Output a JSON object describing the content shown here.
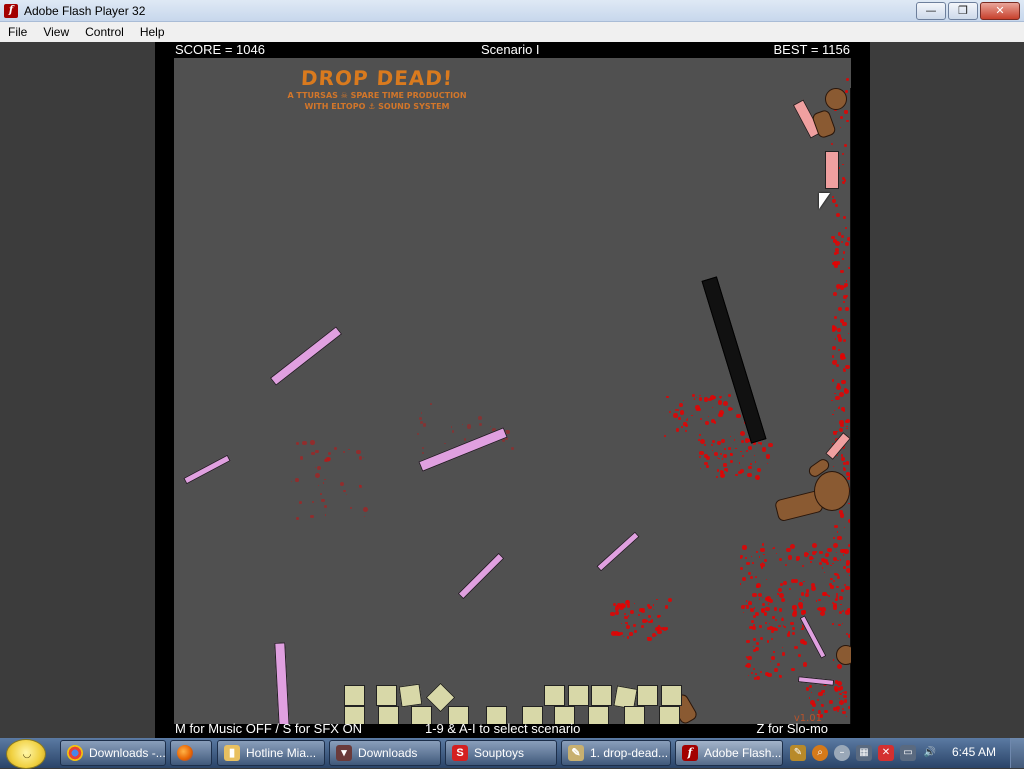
{
  "window": {
    "title": "Adobe Flash Player 32",
    "minimize_glyph": "—",
    "restore_glyph": "❐",
    "close_glyph": "✕"
  },
  "menu": [
    "File",
    "View",
    "Control",
    "Help"
  ],
  "game": {
    "score": "SCORE = 1046",
    "scenario": "Scenario I",
    "best": "BEST = 1156",
    "logo_title": "DROP DEAD!",
    "logo_line1": "A TTURSAS ☠ SPARE TIME PRODUCTION",
    "logo_line2": "WITH ELTOPO ⚓ SOUND SYSTEM",
    "hint_music": "M for Music OFF / S for SFX ON",
    "hint_scenario": "1-9 & A-I to select scenario",
    "hint_slowmo": "Z for Slo-mo",
    "version": "v1.01"
  },
  "colors": {
    "plank_pink": "#e0a0e0",
    "plank_salmon": "#f0a0a0",
    "block_tan": "#d8d8a8",
    "blood": "#e00000",
    "bear": "#8a5a32"
  },
  "taskbar": {
    "items": [
      {
        "label": "Downloads -...",
        "icon": "chrome-icon"
      },
      {
        "label": "",
        "icon": "firefox-icon"
      },
      {
        "label": "Hotline Mia...",
        "icon": "folder-icon"
      },
      {
        "label": "Downloads",
        "icon": "downloads-icon"
      },
      {
        "label": "Souptoys",
        "icon": "souptoys-icon"
      },
      {
        "label": "1. drop-dead...",
        "icon": "notepad-icon"
      },
      {
        "label": "Adobe Flash...",
        "icon": "flash-icon"
      }
    ],
    "clock": "6:45 AM"
  }
}
